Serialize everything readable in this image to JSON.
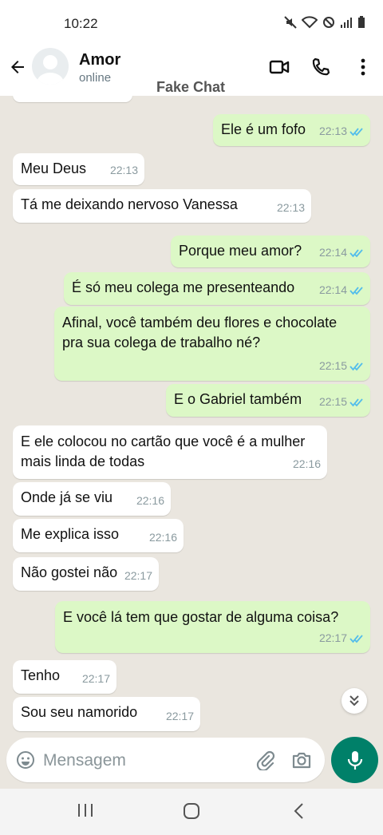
{
  "status_bar": {
    "time": "10:22"
  },
  "contact": {
    "name": "Amor",
    "status": "online"
  },
  "watermark": "Fake Chat",
  "messages": [
    {
      "dir": "out",
      "text": "Ele é um fofo",
      "time": "22:13",
      "read": true
    },
    {
      "dir": "in",
      "text": "Meu Deus",
      "time": "22:13"
    },
    {
      "dir": "in",
      "text": "Tá me deixando nervoso Vanessa",
      "time": "22:13"
    },
    {
      "dir": "out",
      "text": "Porque meu amor?",
      "time": "22:14",
      "read": true
    },
    {
      "dir": "out",
      "text": "É só meu colega me presenteando",
      "time": "22:14",
      "read": true
    },
    {
      "dir": "out",
      "text": "Afinal, você também deu flores e chocolate pra sua colega de trabalho né?",
      "time": "22:15",
      "read": true
    },
    {
      "dir": "out",
      "text": "E o Gabriel também",
      "time": "22:15",
      "read": true
    },
    {
      "dir": "in",
      "text": "E ele colocou no cartão que você é a mulher mais linda de todas",
      "time": "22:16"
    },
    {
      "dir": "in",
      "text": "Onde já se viu",
      "time": "22:16"
    },
    {
      "dir": "in",
      "text": "Me explica isso",
      "time": "22:16"
    },
    {
      "dir": "in",
      "text": "Não gostei não",
      "time": "22:17"
    },
    {
      "dir": "out",
      "text": "E você lá tem que gostar de alguma coisa?",
      "time": "22:17",
      "read": true
    },
    {
      "dir": "in",
      "text": "Tenho",
      "time": "22:17"
    },
    {
      "dir": "in",
      "text": "Sou seu namorido",
      "time": "22:17"
    }
  ],
  "composer": {
    "placeholder": "Mensagem"
  },
  "colors": {
    "header_bg": "#ffffff",
    "outgoing_bubble": "#dcf8c6",
    "incoming_bubble": "#ffffff",
    "chat_bg": "#eae6df",
    "accent": "#008069",
    "read_tick": "#53bdeb"
  },
  "icons": [
    "arrow-back-icon",
    "video-call-icon",
    "phone-icon",
    "more-vert-icon",
    "emoji-icon",
    "attach-icon",
    "camera-icon",
    "mic-icon",
    "chevrons-down-icon",
    "recents-icon",
    "home-icon",
    "nav-back-icon"
  ]
}
